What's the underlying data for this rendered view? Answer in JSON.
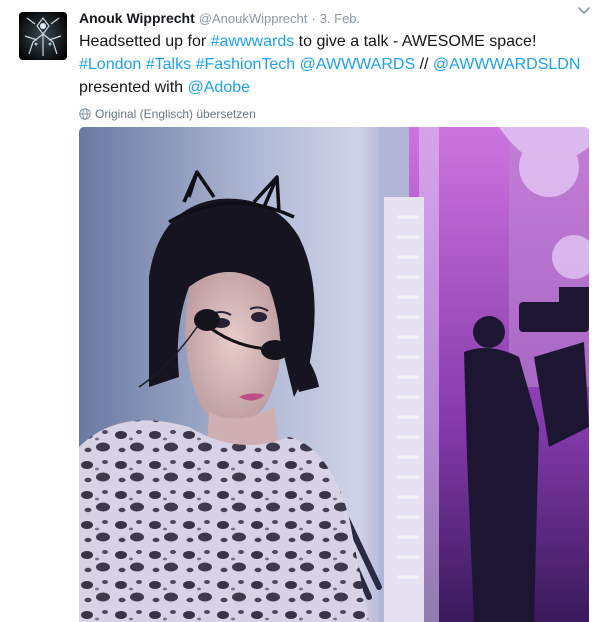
{
  "tweet": {
    "author": {
      "fullname": "Anouk Wipprecht",
      "username": "@AnoukWipprecht",
      "separator": "·",
      "time": "3. Feb.",
      "avatar_icon": "avatar-robot-dress-icon"
    },
    "text": {
      "w1": "Headsetted up for ",
      "h_awwwards": "#awwwards",
      "w2": " to give a talk - AWESOME space!",
      "h_london": "#London",
      "w3": " ",
      "h_talks": "#Talks",
      "w4": " ",
      "h_fashiontech": "#FashionTech",
      "w5": " ",
      "m_awwwards": "@AWWWARDS",
      "w6": " // ",
      "m_awwwardsldn": "@AWWWARDSLDN",
      "w7": " presented with ",
      "m_adobe": "@Adobe"
    },
    "translate_label": "Original (Englisch) übersetzen",
    "icons": {
      "menu": "chevron-down-icon",
      "translate": "globe-icon"
    },
    "colors": {
      "link": "#1da1f2",
      "name": "#14171a",
      "meta": "#8899a6",
      "translate": "#657786"
    }
  }
}
